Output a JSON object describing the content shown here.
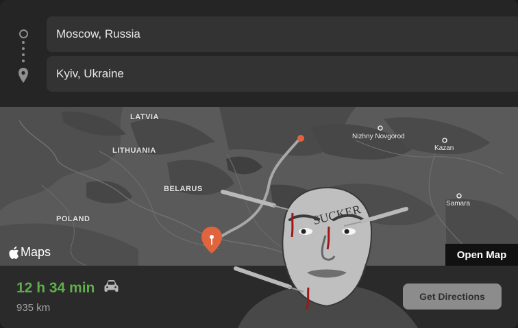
{
  "route": {
    "origin": "Moscow, Russia",
    "destination": "Kyiv, Ukraine"
  },
  "map": {
    "labels": {
      "latvia": "LATVIA",
      "lithuania": "LITHUANIA",
      "belarus": "BELARUS",
      "poland": "POLAND"
    },
    "cities": {
      "nizhny": "Nizhny Novgorod",
      "kazan": "Kazan",
      "samara": "Samara"
    },
    "brand": "Maps",
    "open_map_label": "Open Map"
  },
  "summary": {
    "duration": "12 h 34 min",
    "distance": "935 km",
    "get_directions_label": "Get Directions"
  },
  "overlay": {
    "forehead_text": "SUCKER"
  },
  "colors": {
    "duration": "#5fae4b",
    "pin": "#e0643d"
  },
  "icons": [
    "origin-icon",
    "destination-icon",
    "apple-icon",
    "car-icon",
    "map-pin-icon"
  ]
}
